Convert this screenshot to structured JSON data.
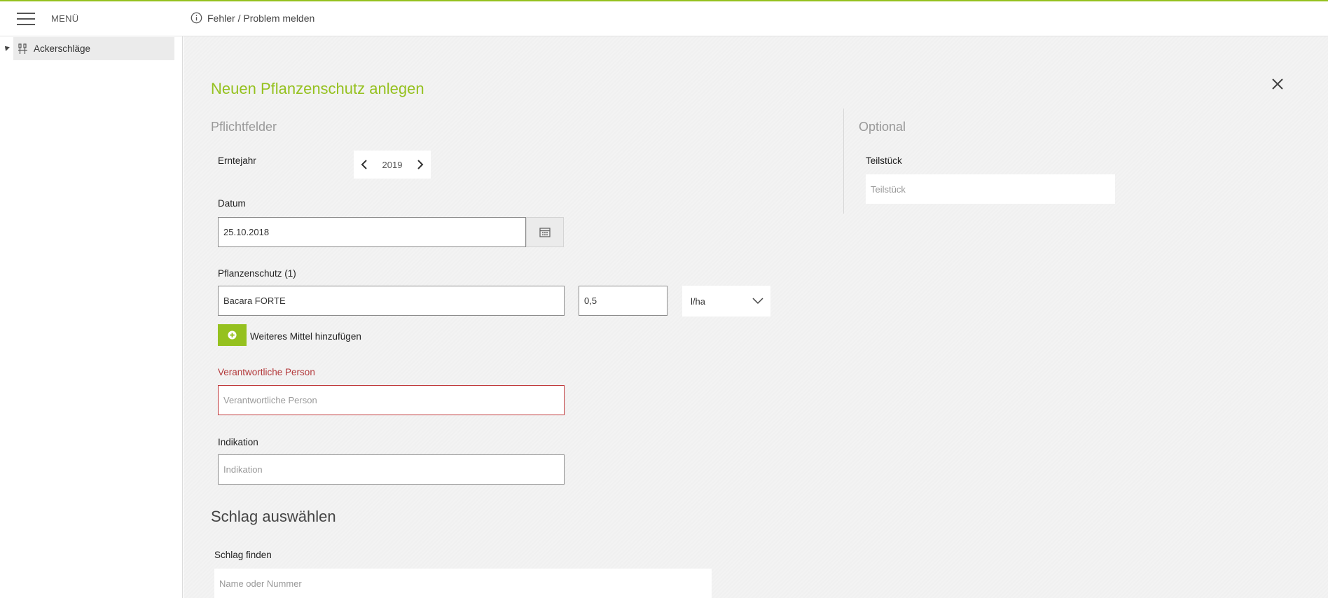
{
  "topbar": {
    "menu_label": "MENÜ",
    "report_label": "Fehler / Problem melden"
  },
  "sidebar": {
    "items": [
      {
        "label": "Ackerschläge",
        "icon": "field-parcels-icon"
      }
    ]
  },
  "form": {
    "title": "Neuen Pflanzenschutz anlegen",
    "required_heading": "Pflichtfelder",
    "optional_heading": "Optional",
    "harvest_year": {
      "label": "Erntejahr",
      "value": "2019"
    },
    "date": {
      "label": "Datum",
      "value": "25.10.2018"
    },
    "protection": {
      "label": "Pflanzenschutz (1)",
      "product": "Bacara FORTE",
      "amount": "0,5",
      "unit": "l/ha"
    },
    "add_more_label": "Weiteres Mittel hinzufügen",
    "responsible": {
      "label": "Verantwortliche Person",
      "placeholder": "Verantwortliche Person"
    },
    "indication": {
      "label": "Indikation",
      "placeholder": "Indikation"
    },
    "partial": {
      "label": "Teilstück",
      "placeholder": "Teilstück"
    },
    "schlag_heading": "Schlag auswählen",
    "schlag_find": {
      "label": "Schlag finden",
      "placeholder": "Name oder Nummer"
    }
  },
  "colors": {
    "accent": "#95c11f",
    "error": "#b3393b"
  }
}
